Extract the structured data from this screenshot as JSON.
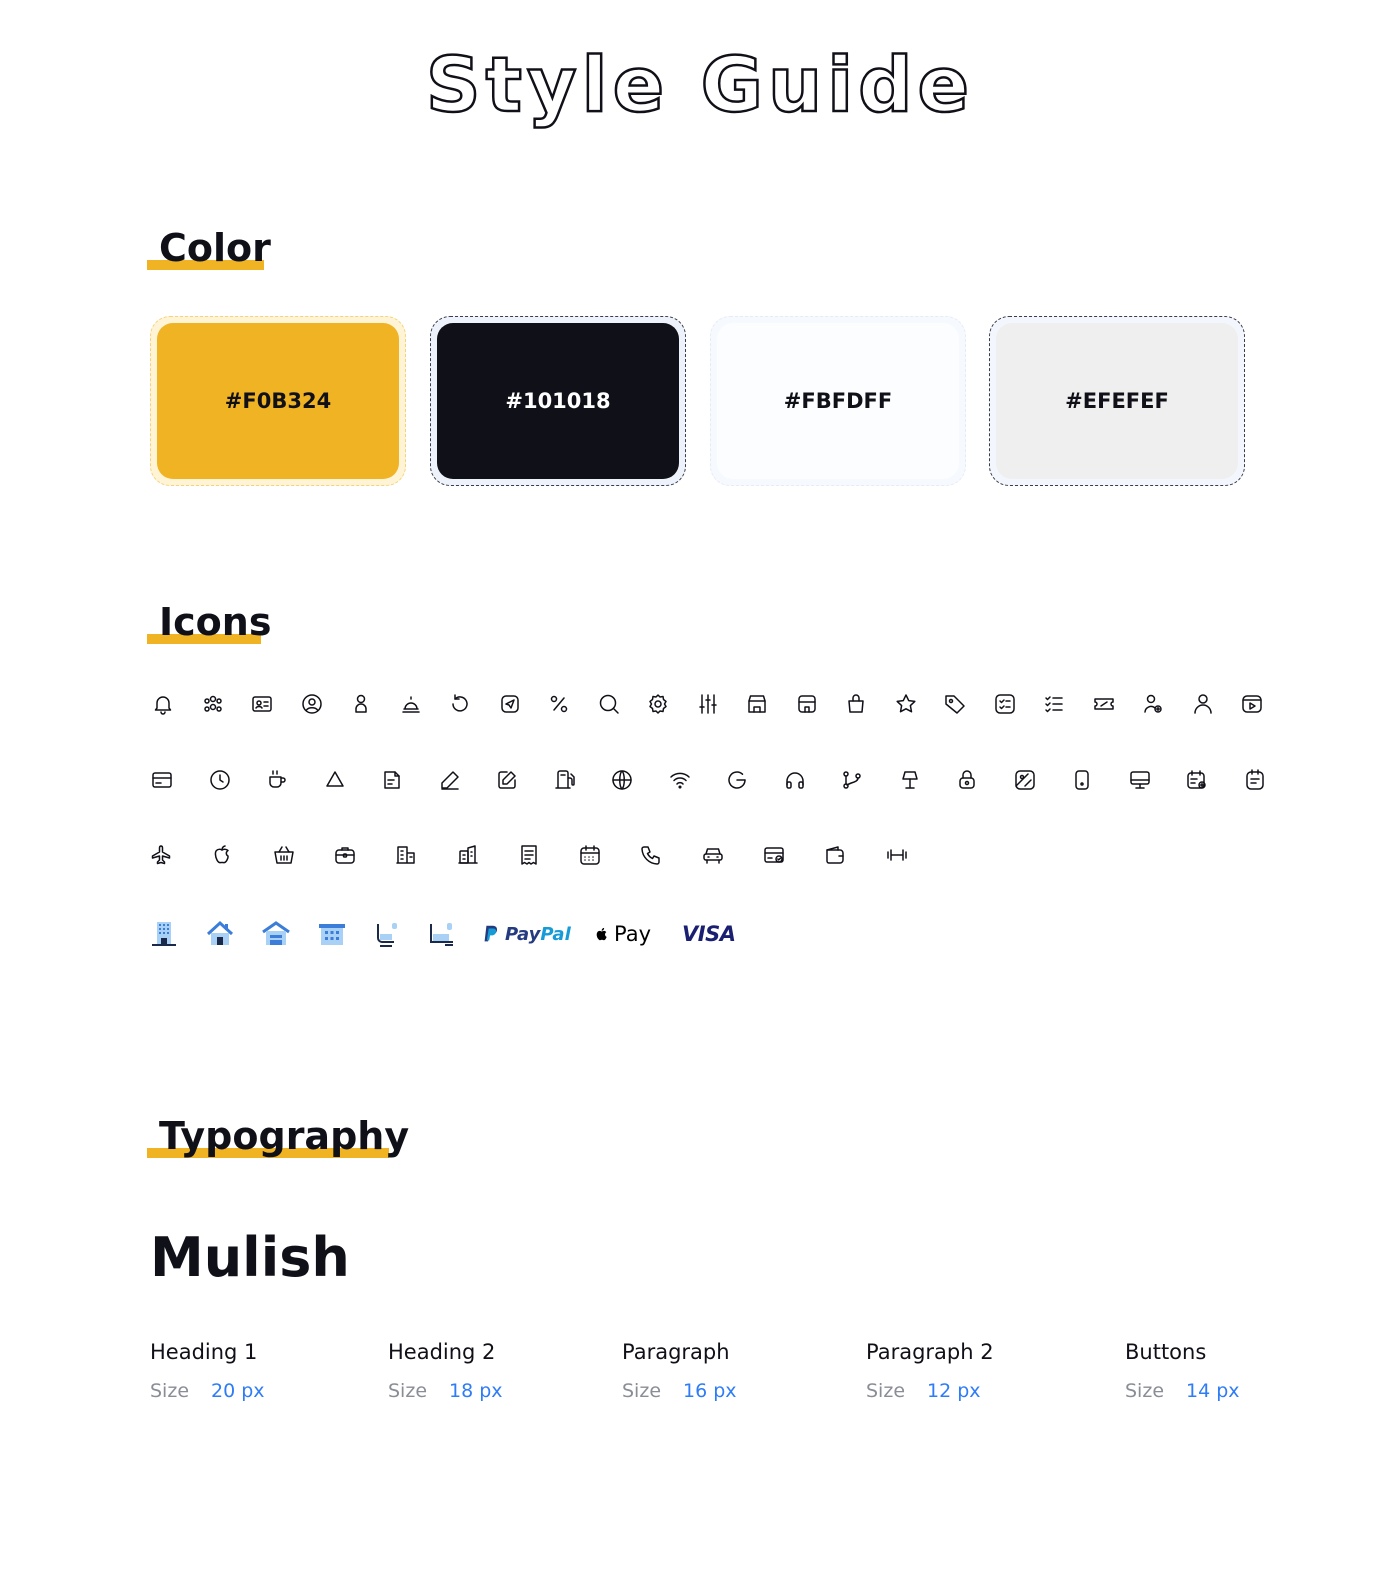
{
  "page_title": "Style Guide",
  "sections": {
    "color": "Color",
    "icons": "Icons",
    "typography": "Typography"
  },
  "colors": [
    {
      "hex": "#F0B324",
      "label": "#F0B324",
      "text_color": "#101018",
      "border": "#F6D37A",
      "halo": "#FFF4D6"
    },
    {
      "hex": "#101018",
      "label": "#101018",
      "text_color": "#FFFFFF",
      "border": "#3A3D4A",
      "halo": "#EEF2FB"
    },
    {
      "hex": "#FBFDFF",
      "label": "#FBFDFF",
      "text_color": "#101018",
      "border": "#E6ECF6",
      "halo": "#F6F9FE"
    },
    {
      "hex": "#EFEFEF",
      "label": "#EFEFEF",
      "text_color": "#101018",
      "border": "#3A3D4A",
      "halo": "#F3F6FC"
    }
  ],
  "accent_color": "#F0B324",
  "text_dark": "#101018",
  "link_blue": "#2E7CF6",
  "icons": {
    "row1": [
      "bell-icon",
      "users-group-icon",
      "id-card-icon",
      "user-circle-icon",
      "user-icon",
      "bell-alt-icon",
      "refresh-icon",
      "send-icon",
      "percent-icon",
      "search-icon",
      "gear-icon",
      "sliders-icon",
      "shop-icon",
      "store-icon",
      "bag-icon",
      "star-icon",
      "tag-icon",
      "checklist-icon",
      "list-icon",
      "ticket-icon",
      "user-add-icon",
      "user-outline-icon",
      "video-icon"
    ],
    "row2": [
      "credit-card-icon",
      "clock-icon",
      "coffee-icon",
      "triangle-icon",
      "document-icon",
      "pen-icon",
      "edit-icon",
      "fuel-icon",
      "globe-icon",
      "wifi-icon",
      "google-icon",
      "headphones-icon",
      "git-branch-icon",
      "lamp-icon",
      "lock-icon",
      "image-icon",
      "phone-device-icon",
      "monitor-icon",
      "calendar-add-icon",
      "note-icon"
    ],
    "row3": [
      "airplane-icon",
      "apple-icon",
      "basket-icon",
      "briefcase-icon",
      "building-icon",
      "buildings-icon",
      "receipt-icon",
      "calendar-icon",
      "phone-icon",
      "car-icon",
      "card-check-icon",
      "wallet-icon",
      "dumbbell-icon"
    ]
  },
  "brand_icons": [
    "hotel-building-icon",
    "house-icon",
    "home-alt-icon",
    "office-building-icon",
    "seat-icon",
    "bed-seat-icon"
  ],
  "payments": {
    "paypal": {
      "pay": "Pay",
      "pal": "Pal"
    },
    "applepay": "Pay",
    "visa": "VISA"
  },
  "typography": {
    "font_name": "Mulish",
    "size_label": "Size",
    "styles": [
      {
        "name": "Heading 1",
        "size": "20 px"
      },
      {
        "name": "Heading 2",
        "size": "18 px"
      },
      {
        "name": "Paragraph",
        "size": "16 px"
      },
      {
        "name": "Paragraph 2",
        "size": "12 px"
      },
      {
        "name": "Buttons",
        "size": "14 px"
      }
    ]
  }
}
